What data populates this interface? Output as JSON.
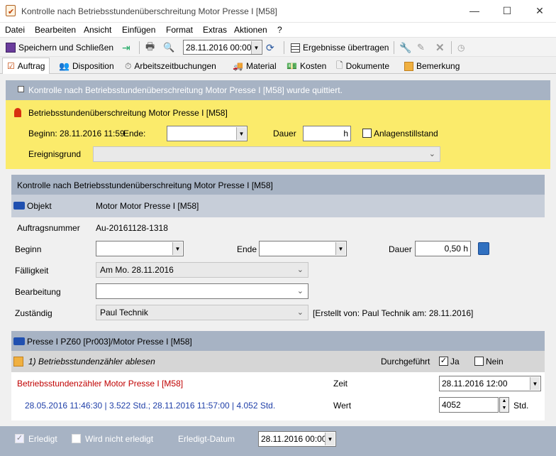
{
  "window": {
    "title": "Kontrolle nach Betriebsstundenüberschreitung Motor Presse I [M58]",
    "minimize": "—",
    "maximize": "☐",
    "close": "✕"
  },
  "menu": [
    "Datei",
    "Bearbeiten",
    "Ansicht",
    "Einfügen",
    "Format",
    "Extras",
    "Aktionen",
    "?"
  ],
  "toolbar": {
    "save_close": "Speichern und Schließen",
    "date_value": "28.11.2016 00:00",
    "transfer": "Ergebnisse übertragen"
  },
  "tabs": [
    "Auftrag",
    "Disposition",
    "Arbeitszeitbuchungen",
    "Material",
    "Kosten",
    "Dokumente",
    "Bemerkung"
  ],
  "acknowledged": "Kontrolle nach Betriebsstundenüberschreitung Motor Presse I [M58] wurde quittiert.",
  "alarm": {
    "title": "Betriebsstundenüberschreitung Motor Presse I [M58]",
    "begin_label": "Beginn: 28.11.2016 11:59",
    "end_label": "Ende:",
    "end_value": "",
    "duration_label": "Dauer",
    "duration_value": "h",
    "standstill_label": "Anlagenstillstand",
    "reason_label": "Ereignisgrund",
    "reason_value": ""
  },
  "order": {
    "header": "Kontrolle nach Betriebsstundenüberschreitung Motor Presse I [M58]",
    "object_label": "Objekt",
    "object_value": "Motor Motor Presse I [M58]",
    "number_label": "Auftragsnummer",
    "number_value": "Au-20161128-1318",
    "begin_label": "Beginn",
    "begin_value": "",
    "end_label": "Ende",
    "end_value": "",
    "duration_label": "Dauer",
    "duration_value": "0,50 h",
    "due_label": "Fälligkeit",
    "due_value": "Am Mo. 28.11.2016",
    "processing_label": "Bearbeitung",
    "processing_value": "",
    "responsible_label": "Zuständig",
    "responsible_value": "Paul Technik",
    "created_by": "[Erstellt von: Paul Technik am: 28.11.2016]"
  },
  "machine": {
    "header": "Presse I PZ60 [Pr003]/Motor Presse I [M58]"
  },
  "task": {
    "title": "1) Betriebsstundenzähler ablesen",
    "done_label": "Durchgeführt",
    "yes_label": "Ja",
    "no_label": "Nein",
    "yes_checked": true,
    "no_checked": false
  },
  "reading": {
    "counter_label": "Betriebsstundenzähler Motor Presse I [M58]",
    "time_label": "Zeit",
    "time_value": "28.11.2016 12:00",
    "history": "28.05.2016 11:46:30 | 3.522 Std.; 28.11.2016 11:57:00 | 4.052 Std.",
    "value_label": "Wert",
    "value_value": "4052",
    "unit": "Std."
  },
  "footer": {
    "done_label": "Erledigt",
    "not_done_label": "Wird nicht erledigt",
    "done_date_label": "Erledigt-Datum",
    "done_date_value": "28.11.2016 00:00"
  },
  "colors": {
    "band": "#a7b3c4",
    "alarm": "#fbeb6b",
    "red_text": "#c00000",
    "blue_text": "#1f3fa8"
  }
}
